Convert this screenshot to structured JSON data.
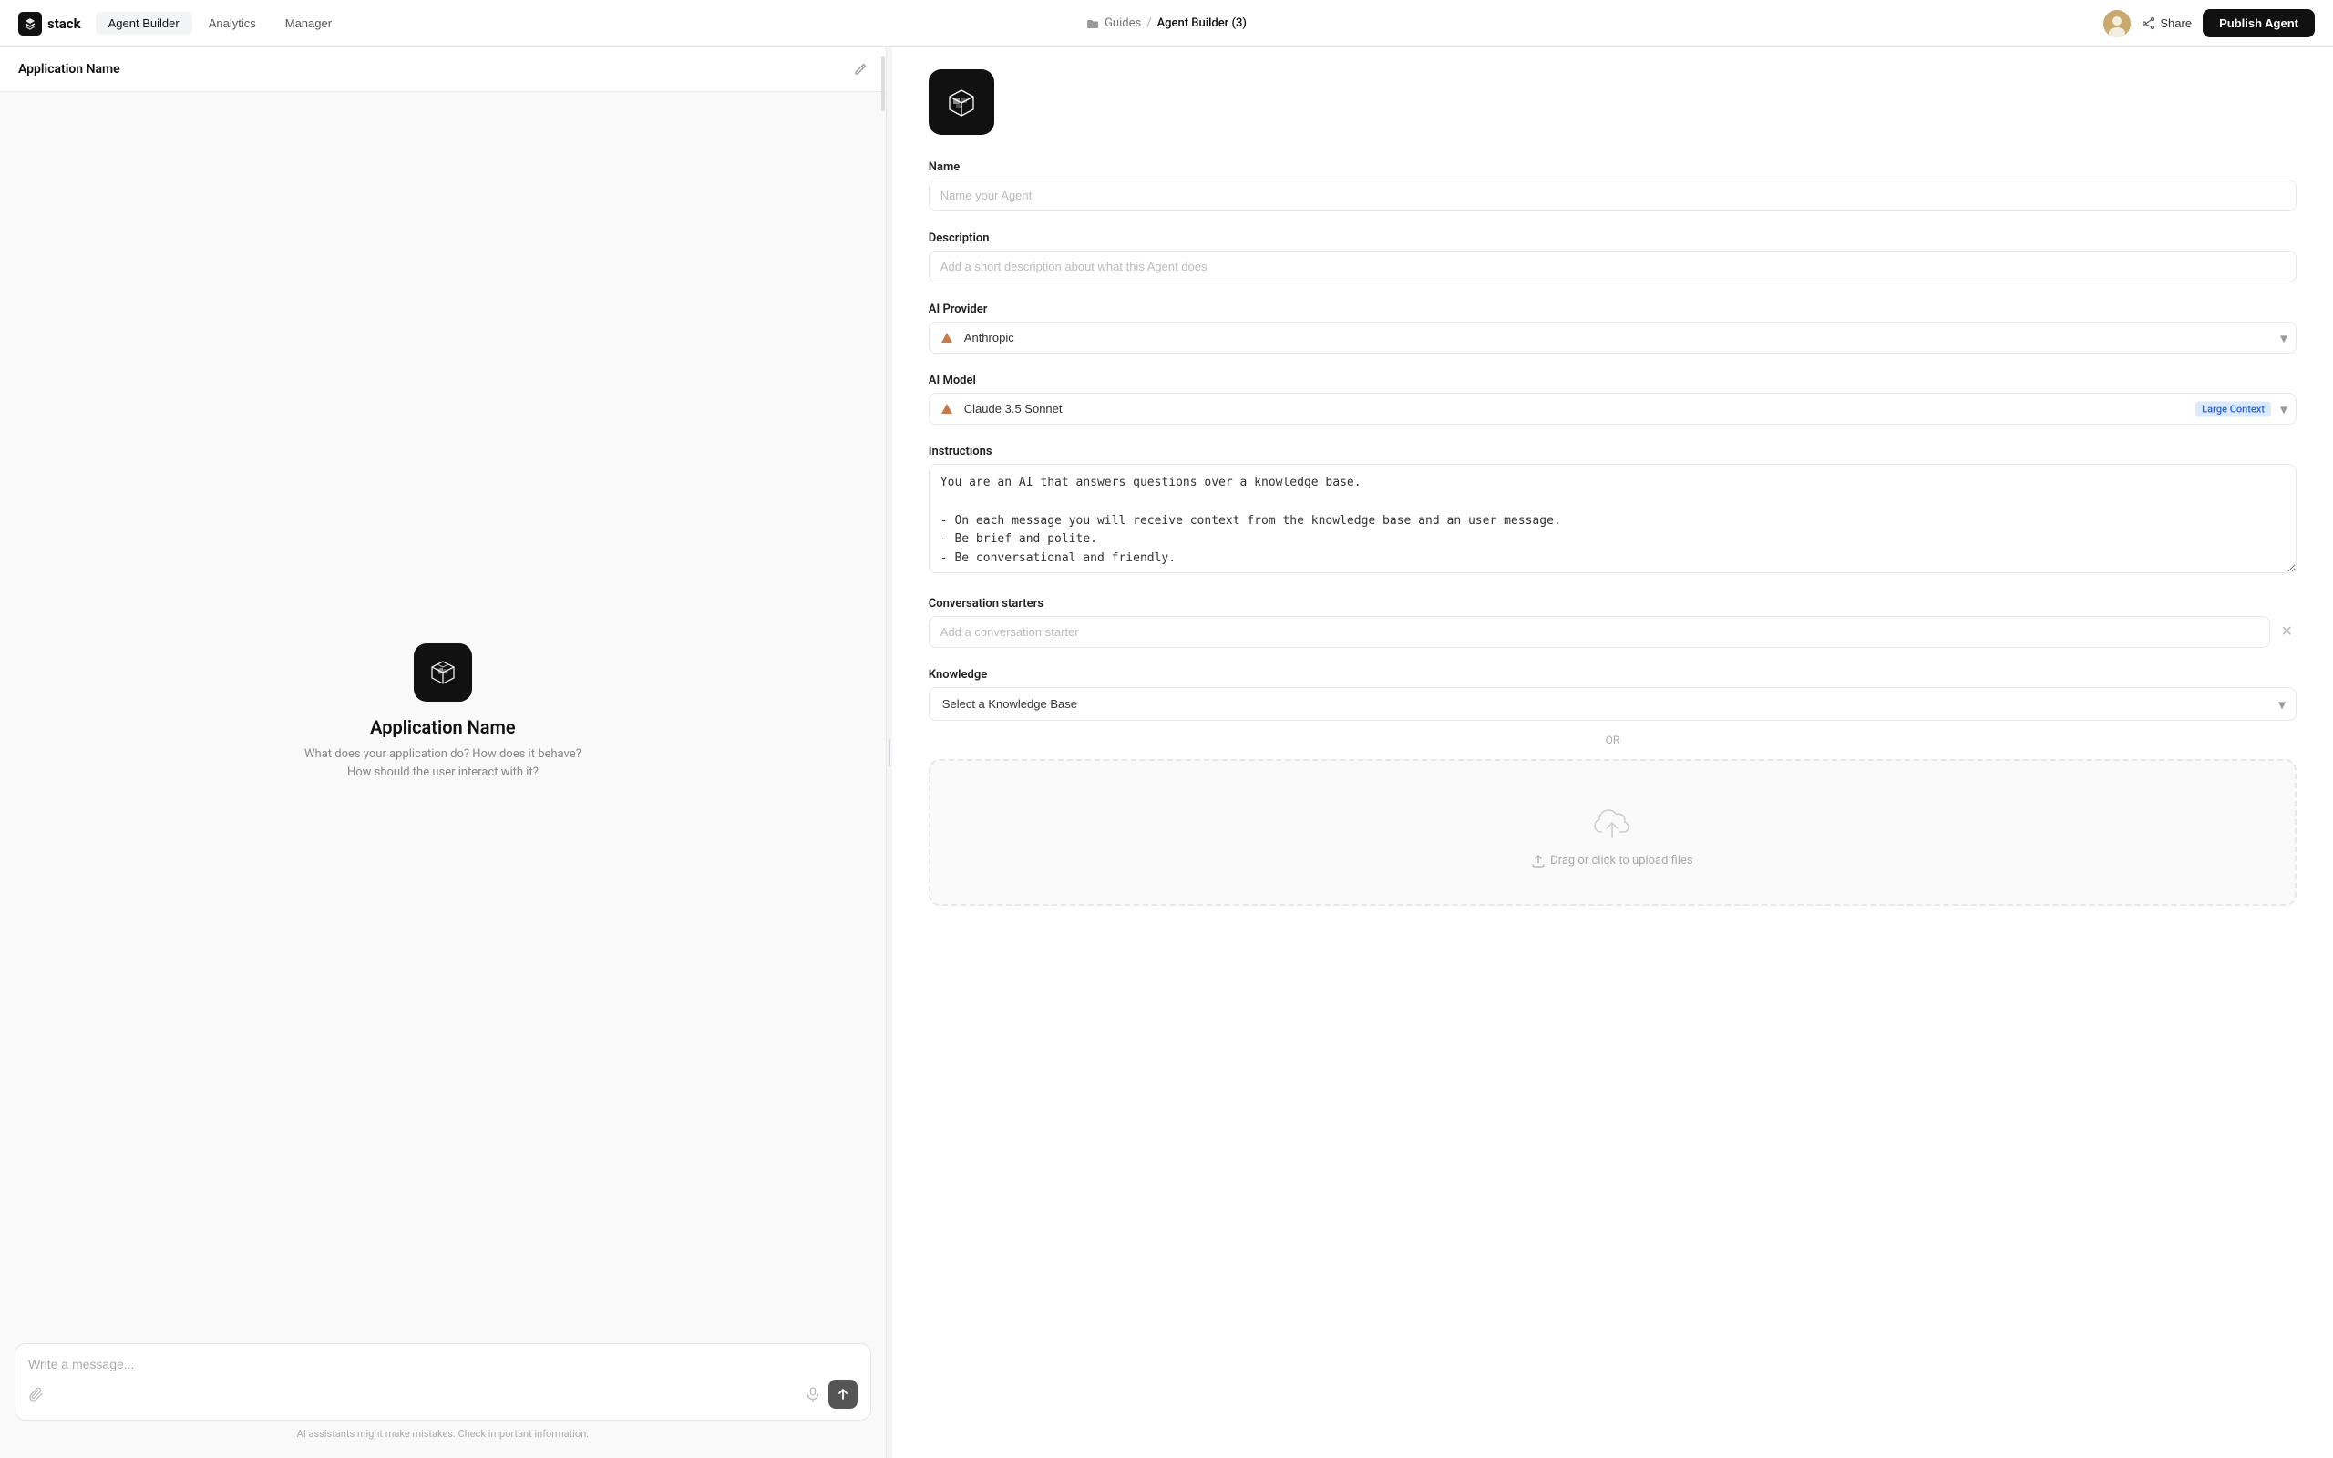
{
  "nav": {
    "logo_text": "stack",
    "tabs": [
      {
        "label": "Agent Builder",
        "active": true
      },
      {
        "label": "Analytics",
        "active": false
      },
      {
        "label": "Manager",
        "active": false
      }
    ],
    "breadcrumb_icon": "folder-icon",
    "breadcrumb_guides": "Guides",
    "breadcrumb_sep": "/",
    "breadcrumb_current": "Agent Builder (3)",
    "share_label": "Share",
    "publish_label": "Publish Agent"
  },
  "left_panel": {
    "header_title": "Application Name",
    "preview_title": "Application Name",
    "preview_desc": "What does your application do? How does it behave? How should the user interact with it?",
    "chat_placeholder": "Write a message...",
    "ai_disclaimer": "AI assistants might make mistakes. Check important information."
  },
  "right_panel": {
    "name_label": "Name",
    "name_placeholder": "Name your Agent",
    "description_label": "Description",
    "description_placeholder": "Add a short description about what this Agent does",
    "ai_provider_label": "AI Provider",
    "ai_provider_value": "Anthropic",
    "ai_model_label": "AI Model",
    "ai_model_value": "Claude 3.5 Sonnet",
    "ai_model_badge": "Large Context",
    "instructions_label": "Instructions",
    "instructions_value": "You are an AI that answers questions over a knowledge base.\n\n- On each message you will receive context from the knowledge base and an user message.\n- Be brief and polite.\n- Be conversational and friendly.",
    "conversation_starters_label": "Conversation starters",
    "conversation_starter_placeholder": "Add a conversation starter",
    "knowledge_label": "Knowledge",
    "knowledge_select_placeholder": "Select a Knowledge Base",
    "or_text": "OR",
    "upload_text": "Drag or click to upload files"
  }
}
